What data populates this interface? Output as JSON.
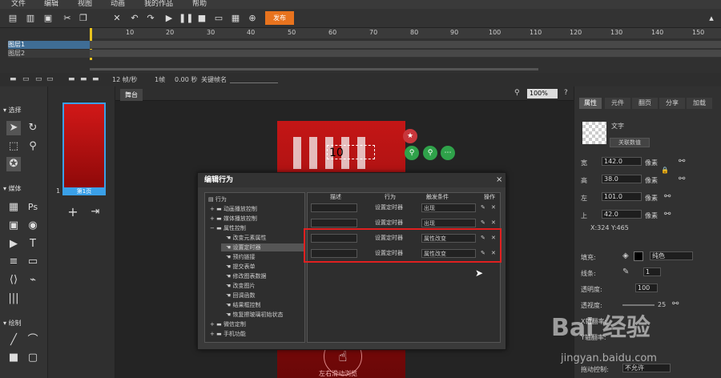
{
  "menu": [
    "文件",
    "编辑",
    "视图",
    "动画",
    "我的作品",
    "帮助"
  ],
  "toolbar": {
    "publish_label": "发布"
  },
  "timeline": {
    "ruler": [
      "10",
      "20",
      "30",
      "40",
      "50",
      "60",
      "70",
      "80",
      "90",
      "100",
      "110",
      "120",
      "130",
      "140",
      "150"
    ],
    "layers": [
      "图层1",
      "图层2"
    ],
    "fps": "12 帧/秒",
    "frame": "1帧",
    "seconds": "0.00 秒",
    "keyframe_label": "关键帧名"
  },
  "left_panel": {
    "select_label": "选择",
    "media_label": "媒体",
    "draw_label": "绘制"
  },
  "pages": {
    "page_number": "1",
    "page_name": "第1页"
  },
  "canvas": {
    "tab": "舞台",
    "zoom": "100%",
    "overlay_number": "10",
    "bottom_text": "左右滑动浏览"
  },
  "right_panel": {
    "tabs": [
      "属性",
      "元件",
      "翻页",
      "分享",
      "加载"
    ],
    "object_type": "文字",
    "link_button": "关联数值",
    "width_label": "宽",
    "width_value": "142.0",
    "height_label": "高",
    "height_value": "38.0",
    "left_label": "左",
    "left_value": "101.0",
    "top_label": "上",
    "top_value": "42.0",
    "unit": "像素",
    "coords": "X:324    Y:465",
    "fill_label": "填充:",
    "fill_value": "纯色",
    "border_label": "线条:",
    "border_value": "1",
    "opacity_label": "透明度:",
    "opacity_value": "100",
    "blur_label": "透视度:",
    "blur_value": "25",
    "xaxis_label": "X轴翻率:",
    "yaxis_label": "Y轴翻率:",
    "drag_label": "拖动控制:",
    "drag_value": "不允许"
  },
  "dialog": {
    "title": "编辑行为",
    "close": "×",
    "tree": [
      {
        "label": "行为",
        "level": 0
      },
      {
        "label": "动画播放控制",
        "level": 1
      },
      {
        "label": "媒体播放控制",
        "level": 1
      },
      {
        "label": "属性控制",
        "level": 1
      },
      {
        "label": "改变元素属性",
        "level": 2
      },
      {
        "label": "设置定时器",
        "level": 2
      },
      {
        "label": "预约链接",
        "level": 2
      },
      {
        "label": "提交表单",
        "level": 2
      },
      {
        "label": "修改图表数据",
        "level": 2
      },
      {
        "label": "改变图片",
        "level": 2
      },
      {
        "label": "回调函数",
        "level": 2
      },
      {
        "label": "结果框控制",
        "level": 2
      },
      {
        "label": "恢复擦玻璃初始状态",
        "level": 2
      },
      {
        "label": "微信定制",
        "level": 1
      },
      {
        "label": "手机功能",
        "level": 1
      }
    ],
    "headers": [
      "描述",
      "行为",
      "触发条件",
      "操作"
    ],
    "rows": [
      {
        "desc": "",
        "action": "设置定时器",
        "trigger": "出现"
      },
      {
        "desc": "",
        "action": "设置定时器",
        "trigger": "出现"
      },
      {
        "desc": "",
        "action": "设置定时器",
        "trigger": "属性改变"
      },
      {
        "desc": "",
        "action": "设置定时器",
        "trigger": "属性改变"
      }
    ]
  },
  "watermark": {
    "brand": "Bai 经验",
    "url": "jingyan.baidu.com"
  }
}
